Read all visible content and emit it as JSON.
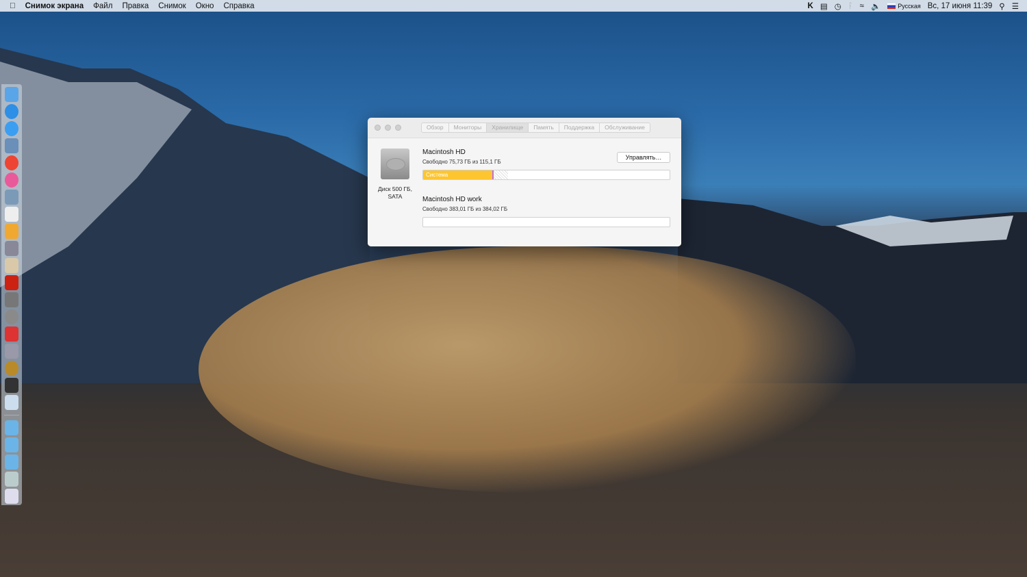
{
  "menubar": {
    "app": "Снимок экрана",
    "items": [
      "Файл",
      "Правка",
      "Снимок",
      "Окно",
      "Справка"
    ],
    "input_source": "Русская",
    "datetime": "Вс, 17 июня  11:39"
  },
  "window": {
    "tabs": [
      {
        "label": "Обзор"
      },
      {
        "label": "Мониторы"
      },
      {
        "label": "Хранилище",
        "active": true
      },
      {
        "label": "Память"
      },
      {
        "label": "Поддержка"
      },
      {
        "label": "Обслуживание"
      }
    ],
    "disk_label": "Диск 500 ГБ, SATA",
    "volumes": [
      {
        "name": "Macintosh HD",
        "free_text": "Свободно 75,73 ГБ из 115,1 ГБ",
        "segments": {
          "system": 0.28,
          "other": 0.006,
          "purgeable": 0.058
        },
        "system_label": "Система"
      },
      {
        "name": "Macintosh HD work",
        "free_text": "Свободно 383,01 ГБ из 384,02 ГБ"
      }
    ],
    "manage_button": "Управлять…"
  },
  "colors": {
    "system": "#fdc52f",
    "other": "#c06ee0"
  }
}
